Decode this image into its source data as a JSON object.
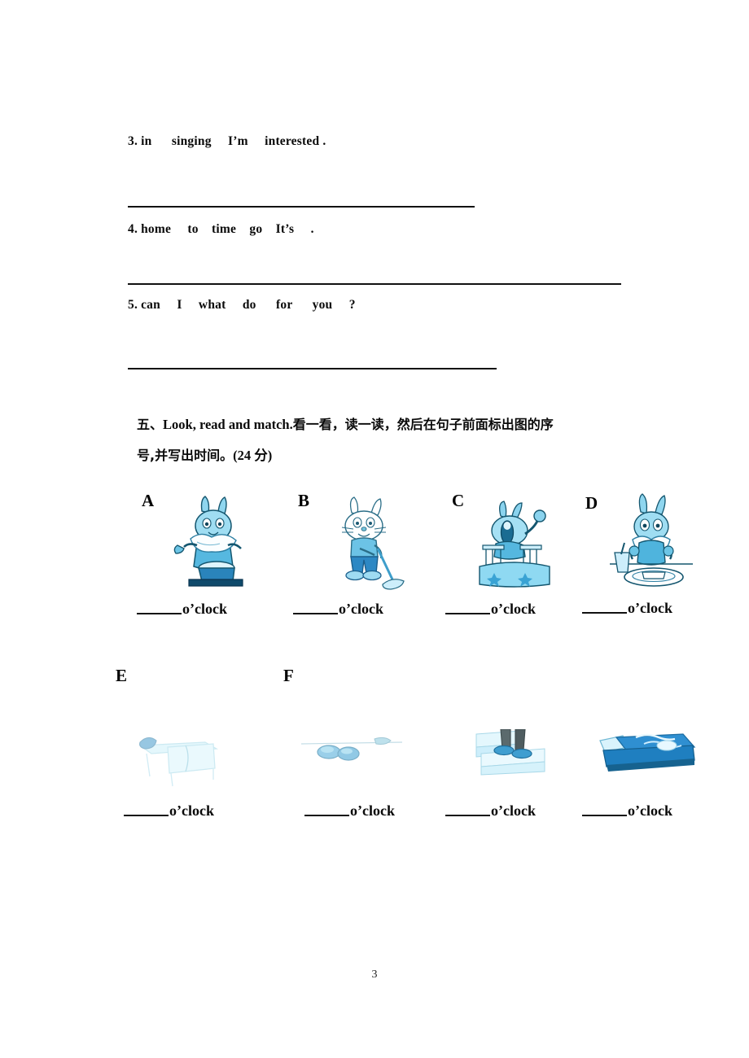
{
  "page": {
    "number": "3",
    "background": "#ffffff",
    "ink": "#0a0a0a"
  },
  "scramble_exercise": {
    "items": [
      {
        "text": "3. in      singing     I’m     interested ."
      },
      {
        "text": "4. home     to    time    go    It’s     ."
      },
      {
        "text": "5. can     I     what     do      for      you     ?"
      }
    ],
    "answer_rules": 3
  },
  "section_five": {
    "marker": "五、",
    "title_en": "Look, read and match.",
    "title_cn_line1": "看一看，读一读，然后在句子前面标出图的序",
    "title_cn_line2": "号,并写出时间。",
    "score": "(24 分)",
    "answer_suffix": "o’clock",
    "pictures": [
      {
        "letter": "A",
        "icon": "rabbit-washing-face-icon",
        "caption": "o’clock",
        "blank": ""
      },
      {
        "letter": "B",
        "icon": "rabbit-mopping-floor-icon",
        "caption": "o’clock",
        "blank": ""
      },
      {
        "letter": "C",
        "icon": "rabbit-waking-up-in-bed-icon",
        "caption": "o’clock",
        "blank": ""
      },
      {
        "letter": "D",
        "icon": "rabbit-eating-meal-icon",
        "caption": "o’clock",
        "blank": ""
      },
      {
        "letter": "E",
        "icon": "faded-desk-chair-icon",
        "caption": "o’clock",
        "blank": ""
      },
      {
        "letter": "F",
        "icon": "faded-shoes-icon",
        "caption": "o’clock",
        "blank": ""
      },
      {
        "letter": "",
        "icon": "legs-on-stairs-icon",
        "caption": "o’clock",
        "blank": ""
      },
      {
        "letter": "",
        "icon": "blue-bed-icon",
        "caption": "o’clock",
        "blank": ""
      }
    ],
    "colors": {
      "clipart_light": "#bfe8f7",
      "clipart_mid": "#5fbfe4",
      "clipart_dark": "#1f7fb8",
      "clipart_deep": "#1766a0",
      "outline": "#14566f"
    }
  }
}
